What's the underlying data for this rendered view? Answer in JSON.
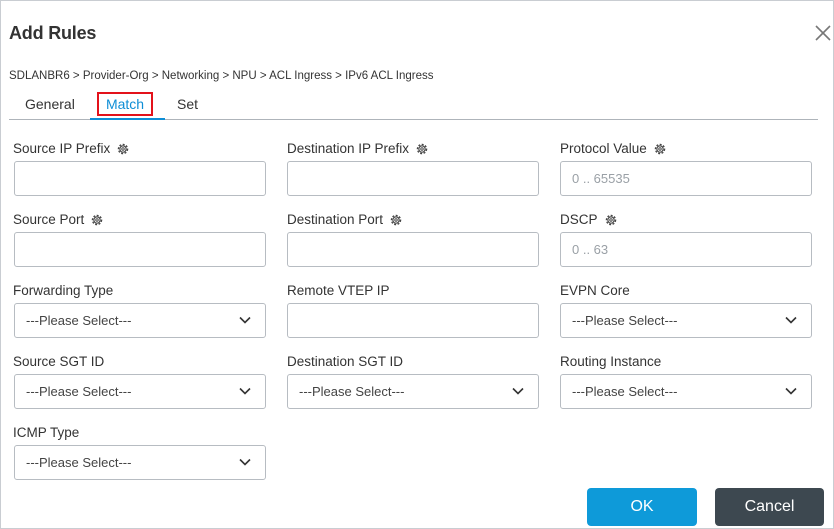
{
  "dialog": {
    "title": "Add Rules",
    "breadcrumb": "SDLANBR6 > Provider-Org > Networking > NPU > ACL Ingress > IPv6 ACL Ingress"
  },
  "tabs": {
    "general": "General",
    "match": "Match",
    "set": "Set",
    "active": "Match"
  },
  "fields": {
    "source_ip_prefix": {
      "label": "Source IP Prefix",
      "value": ""
    },
    "destination_ip_prefix": {
      "label": "Destination IP Prefix",
      "value": ""
    },
    "protocol_value": {
      "label": "Protocol Value",
      "placeholder": "0 .. 65535"
    },
    "source_port": {
      "label": "Source Port",
      "value": ""
    },
    "destination_port": {
      "label": "Destination Port",
      "value": ""
    },
    "dscp": {
      "label": "DSCP",
      "placeholder": "0 .. 63"
    },
    "forwarding_type": {
      "label": "Forwarding Type",
      "selected": "---Please Select---"
    },
    "remote_vtep_ip": {
      "label": "Remote VTEP IP",
      "value": ""
    },
    "evpn_core": {
      "label": "EVPN Core",
      "selected": "---Please Select---"
    },
    "source_sgt_id": {
      "label": "Source SGT ID",
      "selected": "---Please Select---"
    },
    "destination_sgt_id": {
      "label": "Destination SGT ID",
      "selected": "---Please Select---"
    },
    "routing_instance": {
      "label": "Routing Instance",
      "selected": "---Please Select---"
    },
    "icmp_type": {
      "label": "ICMP Type",
      "selected": "---Please Select---"
    }
  },
  "buttons": {
    "ok": "OK",
    "cancel": "Cancel"
  },
  "colors": {
    "accent": "#0e8ed6",
    "ok_button": "#0e9ad9",
    "cancel_button": "#3d4850",
    "highlight_box": "#e3121b"
  },
  "icons": {
    "close": "close-icon",
    "gear": "gear-icon",
    "chevron": "chevron-down-icon"
  }
}
